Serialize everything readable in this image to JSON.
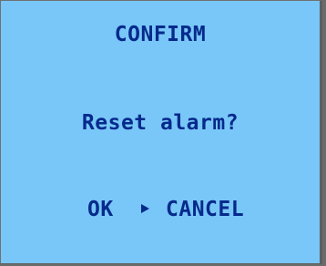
{
  "dialog": {
    "title": "CONFIRM",
    "message": "Reset alarm?",
    "options": [
      {
        "label": "OK",
        "selected": false
      },
      {
        "label": "CANCEL",
        "selected": true
      }
    ],
    "selection_marker_icon": "right-triangle-icon",
    "colors": {
      "screen_background": "#79c7f8",
      "text": "#062a8c"
    }
  }
}
